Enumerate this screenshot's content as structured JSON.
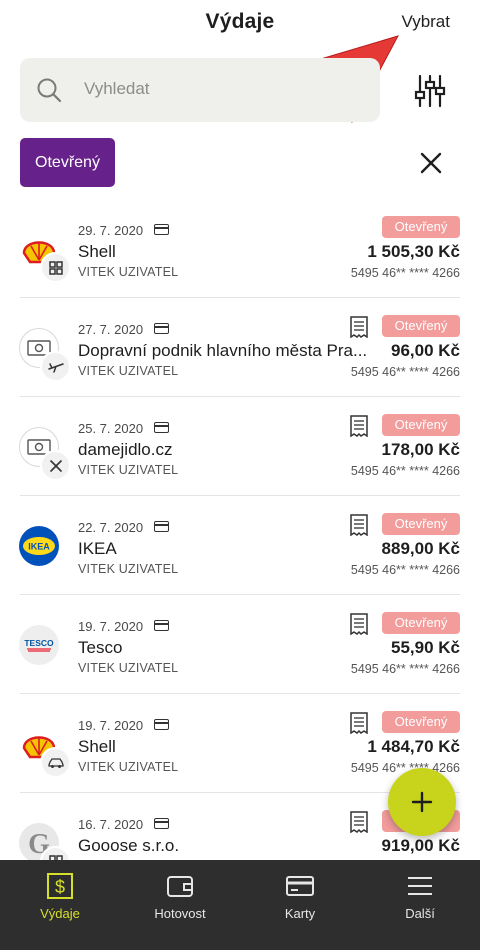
{
  "header": {
    "title": "Výdaje",
    "select_label": "Vybrat"
  },
  "search": {
    "placeholder": "Vyhledat",
    "icon": "search-icon"
  },
  "filter": {
    "icon": "sliders-icon",
    "active_chip": "Otevřený",
    "clear_icon": "close-icon"
  },
  "colors": {
    "accent": "#66228a",
    "status_open": "#f29c9c",
    "fab": "#c7d41b",
    "nav_bg": "#2e2e2e",
    "nav_active": "#d6e02a",
    "annotation_arrow": "#e53935"
  },
  "transactions": [
    {
      "date": "29. 7. 2020",
      "merchant": "Shell",
      "user": "VITEK UZIVATEL",
      "status": "Otevřený",
      "amount": "1 505,30 Kč",
      "card": "5495 46** **** 4266",
      "logo": "shell-logo",
      "category_icon": "grid-icon",
      "has_receipt": false
    },
    {
      "date": "27. 7. 2020",
      "merchant": "Dopravní podnik hlavního města Pra...",
      "user": "VITEK UZIVATEL",
      "status": "Otevřený",
      "amount": "96,00 Kč",
      "card": "5495 46** **** 4266",
      "logo": "cash-icon",
      "category_icon": "plane-icon",
      "has_receipt": true
    },
    {
      "date": "25. 7. 2020",
      "merchant": "damejidlo.cz",
      "user": "VITEK UZIVATEL",
      "status": "Otevřený",
      "amount": "178,00 Kč",
      "card": "5495 46** **** 4266",
      "logo": "cash-icon",
      "category_icon": "cutlery-icon",
      "has_receipt": true
    },
    {
      "date": "22. 7. 2020",
      "merchant": "IKEA",
      "user": "VITEK UZIVATEL",
      "status": "Otevřený",
      "amount": "889,00 Kč",
      "card": "5495 46** **** 4266",
      "logo": "ikea-logo",
      "logo_text": "IKEA",
      "category_icon": "",
      "has_receipt": true
    },
    {
      "date": "19. 7. 2020",
      "merchant": "Tesco",
      "user": "VITEK UZIVATEL",
      "status": "Otevřený",
      "amount": "55,90 Kč",
      "card": "5495 46** **** 4266",
      "logo": "tesco-logo",
      "logo_text": "TESCO",
      "category_icon": "",
      "has_receipt": true
    },
    {
      "date": "19. 7. 2020",
      "merchant": "Shell",
      "user": "VITEK UZIVATEL",
      "status": "Otevřený",
      "amount": "1 484,70 Kč",
      "card": "5495 46** **** 4266",
      "logo": "shell-logo",
      "category_icon": "car-icon",
      "has_receipt": true
    },
    {
      "date": "16. 7. 2020",
      "merchant": "Gooose s.r.o.",
      "user": "",
      "status": "Otevřený",
      "amount": "919,00 Kč",
      "card": "",
      "logo": "letter-logo",
      "logo_text": "G",
      "category_icon": "grid-icon",
      "has_receipt": true
    }
  ],
  "fab": {
    "icon": "plus-icon"
  },
  "bottom_nav": [
    {
      "label": "Výdaje",
      "icon": "dollar-icon",
      "active": true
    },
    {
      "label": "Hotovost",
      "icon": "wallet-icon",
      "active": false
    },
    {
      "label": "Karty",
      "icon": "card-icon",
      "active": false
    },
    {
      "label": "Další",
      "icon": "menu-icon",
      "active": false
    }
  ]
}
